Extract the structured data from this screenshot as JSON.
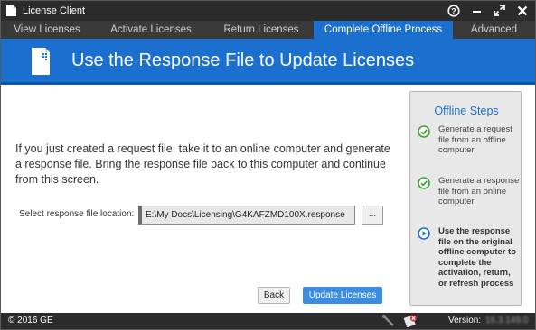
{
  "window": {
    "title": "License Client",
    "title_icon": "license-client-app-icon"
  },
  "titlebar_buttons": {
    "help": "?",
    "minimize": "–",
    "maximize": "⤢",
    "close": "✕"
  },
  "tabs": [
    {
      "label": "View Licenses",
      "active": false
    },
    {
      "label": "Activate Licenses",
      "active": false
    },
    {
      "label": "Return Licenses",
      "active": false
    },
    {
      "label": "Complete Offline Process",
      "active": true
    },
    {
      "label": "Advanced",
      "active": false
    }
  ],
  "header": {
    "title": "Use the Response File to Update Licenses",
    "icon": "document-icon"
  },
  "main": {
    "instructions": "If you just created a request file, take it to an online computer and generate a response file. Bring the response file back to this computer and continue from this screen.",
    "file_label": "Select response file location:",
    "file_value": "E:\\My Docs\\Licensing\\G4KAFZMD100X.response",
    "browse_label": "...",
    "back_label": "Back",
    "update_label": "Update Licenses"
  },
  "steps": {
    "title": "Offline Steps",
    "items": [
      {
        "text": "Generate a request file from an offline computer",
        "status": "done"
      },
      {
        "text": "Generate a response file from an online computer",
        "status": "done"
      },
      {
        "text": "Use the response file on the original offline computer to complete the activation, return, or refresh process",
        "status": "current"
      }
    ]
  },
  "statusbar": {
    "copyright": "© 2016 GE",
    "version_label": "Version:",
    "version_value": "16.3.149.0"
  },
  "colors": {
    "accent": "#1a6fcf",
    "done": "#3aa335",
    "titlebar": "#2b2b2b",
    "tabbar": "#3a3a3a",
    "panel": "#e8e8e8"
  }
}
